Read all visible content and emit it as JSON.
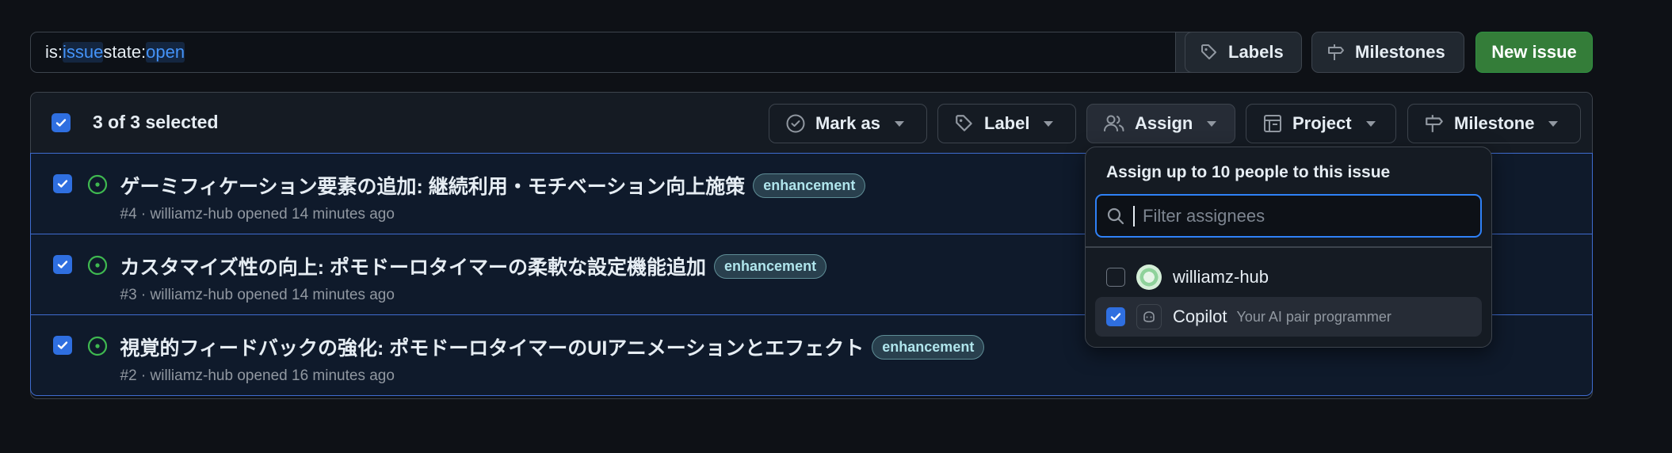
{
  "search": {
    "q1": "is:",
    "v1": "issue",
    "q2": " state:",
    "v2": "open"
  },
  "header": {
    "labels": "Labels",
    "milestones": "Milestones",
    "new_issue": "New issue"
  },
  "bulk_bar": {
    "selected": "3 of 3 selected",
    "mark_as": "Mark as",
    "label": "Label",
    "assign": "Assign",
    "project": "Project",
    "milestone": "Milestone"
  },
  "issues": [
    {
      "title": "ゲーミフィケーション要素の追加: 継続利用・モチベーション向上施策",
      "label": "enhancement",
      "meta": "#4 · williamz-hub opened 14 minutes ago"
    },
    {
      "title": "カスタマイズ性の向上: ポモドーロタイマーの柔軟な設定機能追加",
      "label": "enhancement",
      "meta": "#3 · williamz-hub opened 14 minutes ago"
    },
    {
      "title": "視覚的フィードバックの強化: ポモドーロタイマーのUIアニメーションとエフェクト",
      "label": "enhancement",
      "meta": "#2 · williamz-hub opened 16 minutes ago"
    }
  ],
  "assign_menu": {
    "title": "Assign up to 10 people to this issue",
    "filter_placeholder": "Filter assignees",
    "users": [
      {
        "name": "williamz-hub",
        "desc": "",
        "checked": false
      },
      {
        "name": "Copilot",
        "desc": "Your AI pair programmer",
        "checked": true
      }
    ]
  },
  "colors": {
    "accent": "#2f81f7",
    "open_green": "#3fb950",
    "new_issue_green": "#347d39",
    "label_text": "#b0e5ec"
  },
  "icons": [
    "search-icon",
    "tag-icon",
    "milestone-icon",
    "check-circle-icon",
    "people-icon",
    "project-icon",
    "issue-open-icon",
    "copilot-icon"
  ]
}
